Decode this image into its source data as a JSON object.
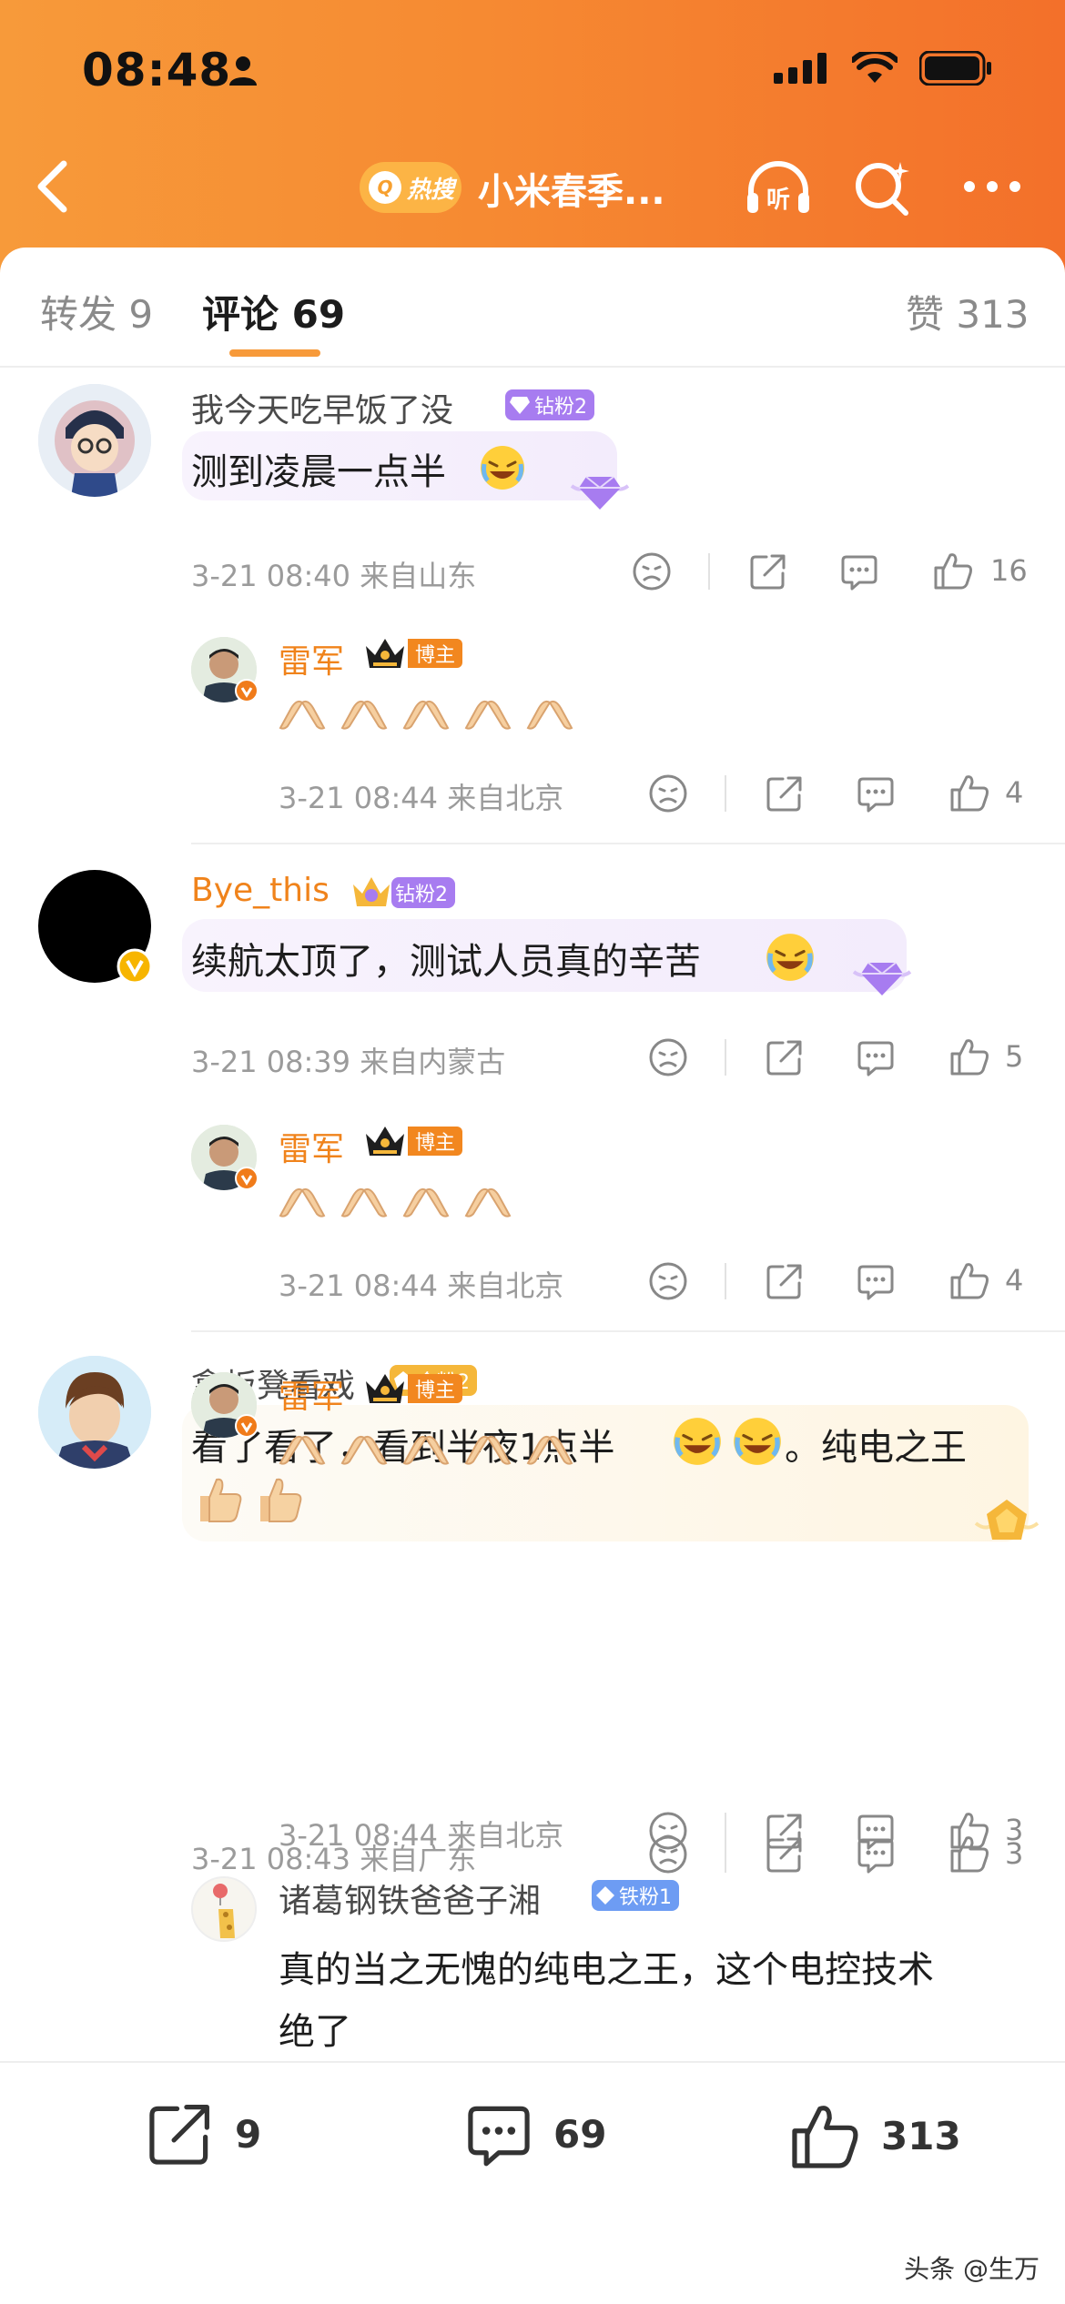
{
  "status_bar": {
    "time": "08:48"
  },
  "nav": {
    "hot_label": "热搜",
    "title": "小米春季..."
  },
  "tabs": {
    "repost": "转发 9",
    "comments": "评论 69",
    "likes": "赞 313"
  },
  "comments": [
    {
      "user": "我今天吃早饭了没",
      "badge": "钻粉2",
      "text": "测到凌晨一点半",
      "meta": "3-21 08:40 来自山东",
      "likes": "16",
      "reply": {
        "user": "雷军",
        "badge": "博主",
        "hands": 5,
        "meta": "3-21 08:44 来自北京",
        "likes": "4"
      }
    },
    {
      "user": "Bye_this",
      "badge": "钻粉2",
      "text": "续航太顶了，测试人员真的辛苦",
      "meta": "3-21 08:39 来自内蒙古",
      "likes": "5",
      "reply": {
        "user": "雷军",
        "badge": "博主",
        "hands": 4,
        "meta": "3-21 08:44 来自北京",
        "likes": "4"
      }
    },
    {
      "user": "拿板凳看戏",
      "badge": "金粉2",
      "text": "看了看了，看到半夜1点半",
      "text_tail": "。纯电之王",
      "meta": "3-21 08:43 来自广东",
      "likes": "3",
      "reply": {
        "user": "雷军",
        "badge": "博主",
        "hands": 5,
        "meta": "3-21 08:44 来自北京",
        "likes": "3"
      },
      "reply2": {
        "user": "诸葛钢铁爸爸子湘",
        "badge": "铁粉1",
        "text_line1": "真的当之无愧的纯电之王，这个电控技术",
        "text_line2": "绝了"
      }
    }
  ],
  "bottom_bar": {
    "reposts": "9",
    "comments": "69",
    "likes": "313"
  },
  "watermark": "头条 @生万",
  "colors": {
    "header_orange": "#f68a32",
    "accent_orange": "#f0831b",
    "diamond_purple": "#a77cf0",
    "gold": "#f5b73a",
    "iron_blue": "#6d9cf3"
  }
}
